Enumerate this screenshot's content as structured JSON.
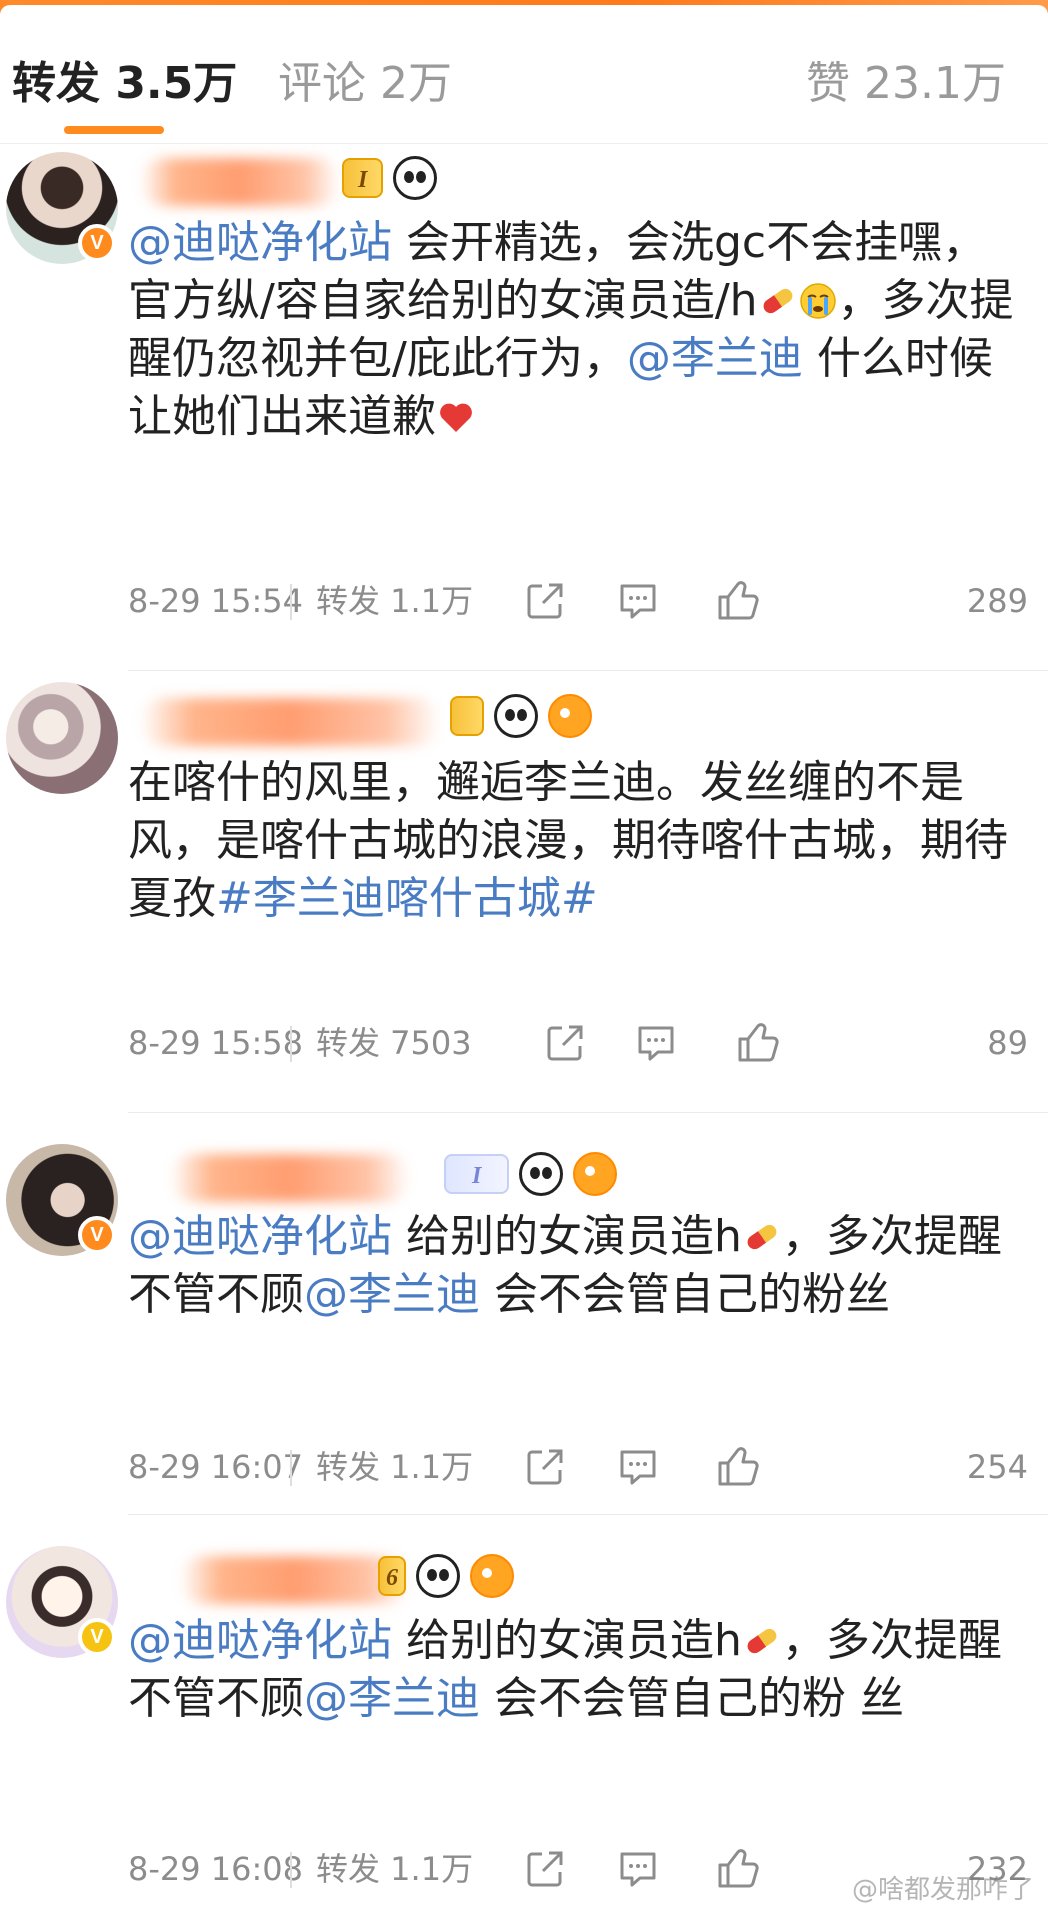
{
  "tabs": {
    "repost": "转发 3.5万",
    "comment": "评论 2万",
    "like": "赞 23.1万"
  },
  "comments": [
    {
      "segments": [
        {
          "t": "@迪哒净化站",
          "k": "mention"
        },
        {
          "t": " 会开精选，会洗gc不会挂嘿， 官方纵/容自家给别的女演员造/h",
          "k": "text"
        },
        {
          "t": "pill",
          "k": "emoji"
        },
        {
          "t": "cry",
          "k": "emoji"
        },
        {
          "t": "，多次提醒仍忽视并包/庇此行为，",
          "k": "text"
        },
        {
          "t": "@李兰迪",
          "k": "mention"
        },
        {
          "t": " 什么时候让她们出来道歉",
          "k": "text"
        },
        {
          "t": "heart",
          "k": "emoji"
        }
      ],
      "time": "8-29 15:54",
      "repost": "转发 1.1万",
      "likes": "289"
    },
    {
      "segments": [
        {
          "t": "在喀什的风里，邂逅李兰迪。发丝缠的不是风，是喀什古城的浪漫，期待喀什古城，期待夏孜",
          "k": "text"
        },
        {
          "t": "#李兰迪喀什古城#",
          "k": "topic"
        }
      ],
      "time": "8-29 15:58",
      "repost": "转发 7503",
      "likes": "89"
    },
    {
      "segments": [
        {
          "t": "@迪哒净化站",
          "k": "mention"
        },
        {
          "t": " 给别的女演员造h",
          "k": "text"
        },
        {
          "t": "pill",
          "k": "emoji"
        },
        {
          "t": "，多次提醒不管不顾",
          "k": "text"
        },
        {
          "t": "@李兰迪",
          "k": "mention"
        },
        {
          "t": " 会不会管自己的粉丝",
          "k": "text"
        }
      ],
      "time": "8-29 16:07",
      "repost": "转发 1.1万",
      "likes": "254"
    },
    {
      "segments": [
        {
          "t": "@迪哒净化站",
          "k": "mention"
        },
        {
          "t": " 给别的女演员造h",
          "k": "text"
        },
        {
          "t": "pill",
          "k": "emoji"
        },
        {
          "t": "，多次提醒不管不顾",
          "k": "text"
        },
        {
          "t": "@李兰迪",
          "k": "mention"
        },
        {
          "t": " 会不会管自己的粉 丝",
          "k": "text"
        }
      ],
      "time": "8-29 16:08",
      "repost": "转发 1.1万",
      "likes": "232"
    }
  ],
  "badges": {
    "level_1": "I",
    "level_2": "I",
    "level_4": "6"
  },
  "verified_mark": "V",
  "watermark": "@啥都发那咋了",
  "colors": {
    "accent": "#ff8a1e",
    "link": "#4a7cc4",
    "meta": "#8c8c8c"
  }
}
